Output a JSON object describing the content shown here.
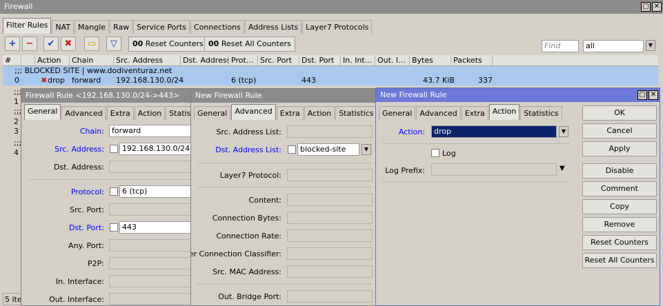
{
  "main_window": {
    "title": "Firewall",
    "tabs": [
      "Filter Rules",
      "NAT",
      "Mangle",
      "Raw",
      "Service Ports",
      "Connections",
      "Address Lists",
      "Layer7 Protocols"
    ],
    "reset_counters": "Reset Counters",
    "reset_all_counters": "Reset All Counters",
    "find_placeholder": "Find",
    "filter_value": "all",
    "columns": [
      "#",
      "",
      "Action",
      "Chain",
      "Src. Address",
      "Dst. Address",
      "Prot...",
      "Src. Port",
      "Dst. Port",
      "In. Int...",
      "Out. I...",
      "Bytes",
      "Packets"
    ],
    "comment_row": ";;; BLOCKED SITE | www.dodiventuraz.net",
    "rule": {
      "num": "0",
      "action": "drop",
      "chain": "forward",
      "src": "192.168.130.0/24",
      "proto": "6 (tcp)",
      "dst_port": "443",
      "bytes": "43.7 KiB",
      "packets": "337"
    },
    "left_rows": [
      ";;;",
      "1",
      ";;;",
      "2",
      "3",
      ";;;",
      "4"
    ],
    "status": "5 ite"
  },
  "win1": {
    "title": "Firewall Rule <192.168.130.0/24->443>",
    "tabs": [
      "General",
      "Advanced",
      "Extra",
      "Action",
      "Statistics"
    ],
    "chain_label": "Chain:",
    "chain_value": "forward",
    "src_label": "Src. Address:",
    "src_value": "192.168.130.0/24",
    "dst_label": "Dst. Address:",
    "proto_label": "Protocol:",
    "proto_value": "6 (tcp)",
    "srcport_label": "Src. Port:",
    "dstport_label": "Dst. Port:",
    "dstport_value": "443",
    "anyport_label": "Any. Port:",
    "p2p_label": "P2P:",
    "inif_label": "In. Interface:",
    "outif_label": "Out. Interface:"
  },
  "win2": {
    "title": "New Firewall Rule",
    "tabs": [
      "General",
      "Advanced",
      "Extra",
      "Action",
      "Statistics"
    ],
    "srclist_label": "Src. Address List:",
    "dstlist_label": "Dst. Address List:",
    "dstlist_value": "blocked-site",
    "l7_label": "Layer7 Protocol:",
    "content_label": "Content:",
    "connbytes_label": "Connection Bytes:",
    "connrate_label": "Connection Rate:",
    "pcc_label": "Per Connection Classifier:",
    "srcmac_label": "Src. MAC Address:",
    "outbridge_label": "Out. Bridge Port:"
  },
  "win3": {
    "title": "New Firewall Rule",
    "tabs": [
      "General",
      "Advanced",
      "Extra",
      "Action",
      "Statistics"
    ],
    "action_label": "Action:",
    "action_value": "drop",
    "log_label": "Log",
    "logprefix_label": "Log Prefix:",
    "buttons": [
      "OK",
      "Cancel",
      "Apply",
      "Disable",
      "Comment",
      "Copy",
      "Remove",
      "Reset Counters",
      "Reset All Counters"
    ]
  }
}
